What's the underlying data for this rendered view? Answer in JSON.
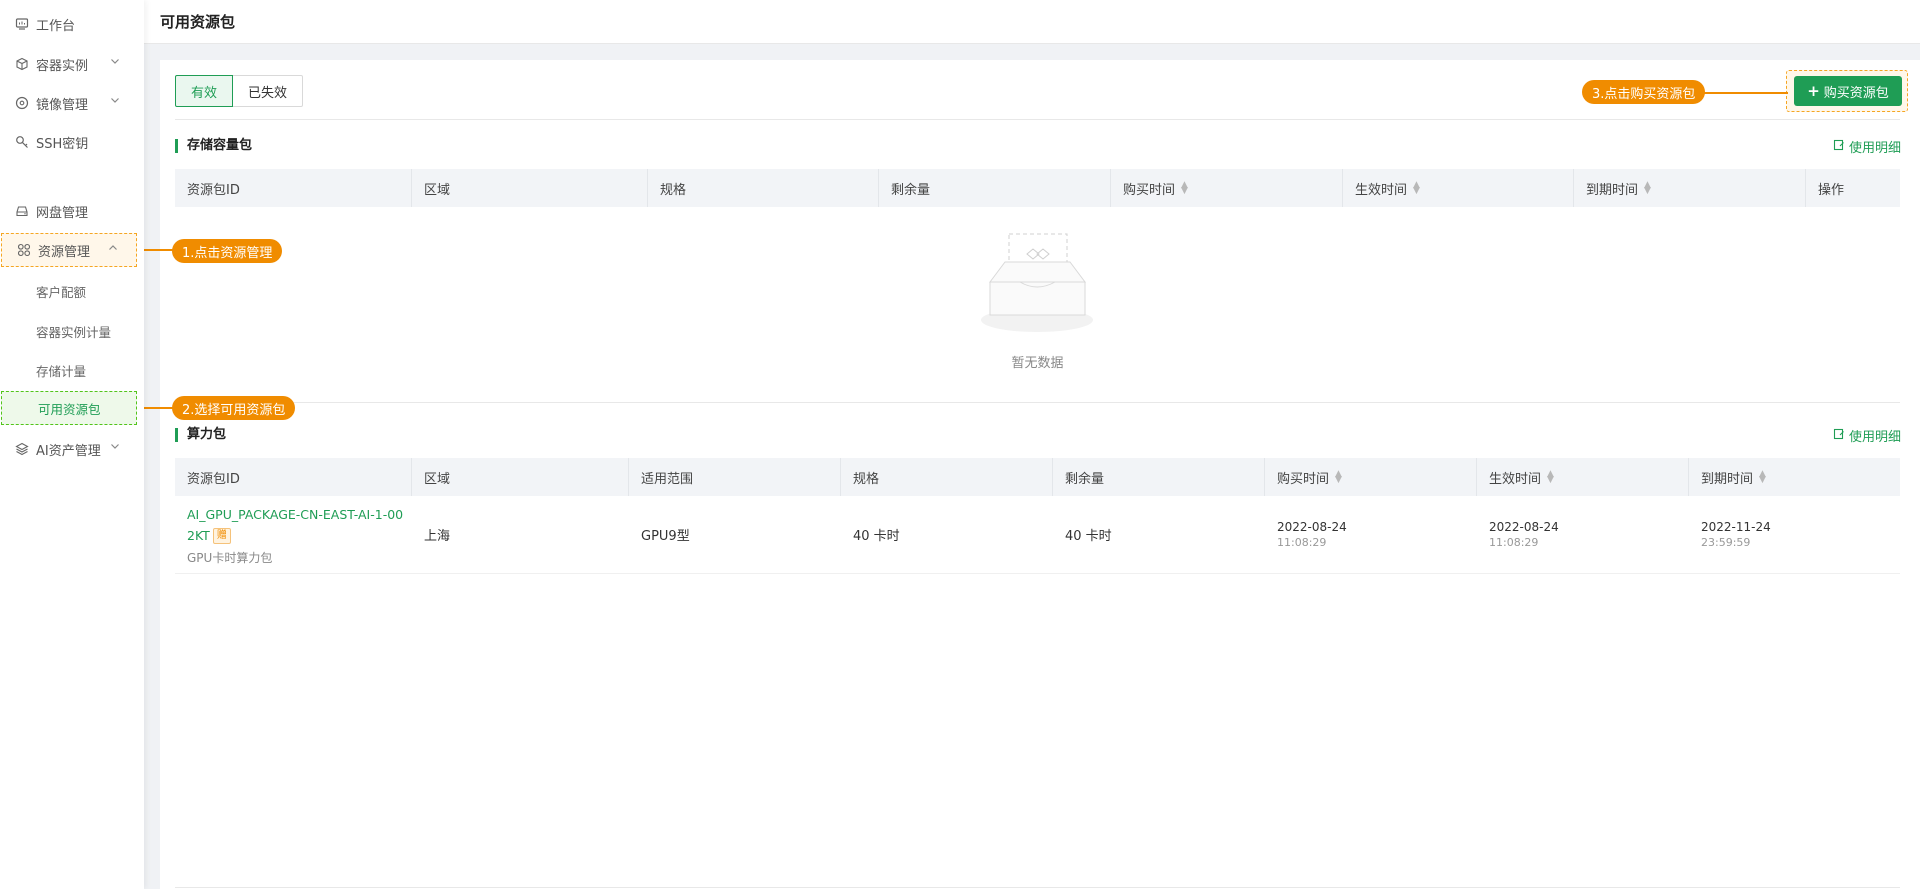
{
  "sidebar": {
    "items": [
      {
        "label": "工作台",
        "icon": "monitor-icon"
      },
      {
        "label": "容器实例",
        "icon": "cube-icon",
        "expand": "down"
      },
      {
        "label": "镜像管理",
        "icon": "disc-icon",
        "expand": "down"
      },
      {
        "label": "SSH密钥",
        "icon": "key-icon"
      },
      {
        "label": "网盘管理",
        "icon": "drive-icon"
      },
      {
        "label": "资源管理",
        "icon": "grid-icon",
        "expand": "up"
      },
      {
        "label": "AI资产管理",
        "icon": "layers-icon",
        "expand": "down"
      }
    ],
    "sub_items": [
      "客户配额",
      "容器实例计量",
      "存储计量",
      "可用资源包"
    ]
  },
  "header": {
    "title": "可用资源包"
  },
  "tabs": {
    "active": "有效",
    "inactive": "已失效"
  },
  "buy_button": {
    "label": "购买资源包"
  },
  "storage": {
    "title": "存储容量包",
    "detail_link": "使用明细",
    "columns": [
      "资源包ID",
      "区域",
      "规格",
      "剩余量",
      "购买时间",
      "生效时间",
      "到期时间",
      "操作"
    ],
    "empty_text": "暂无数据"
  },
  "compute": {
    "title": "算力包",
    "detail_link": "使用明细",
    "columns": [
      "资源包ID",
      "区域",
      "适用范围",
      "规格",
      "剩余量",
      "购买时间",
      "生效时间",
      "到期时间"
    ],
    "row": {
      "id_line1": "AI_GPU_PACKAGE-CN-EAST-AI-1-00",
      "id_line2": "2KT",
      "badge": "赠",
      "subtitle": "GPU卡时算力包",
      "region": "上海",
      "scope": "GPU9型",
      "spec": "40 卡时",
      "remaining": "40 卡时",
      "buy_date": "2022-08-24",
      "buy_time": "11:08:29",
      "start_date": "2022-08-24",
      "start_time": "11:08:29",
      "end_date": "2022-11-24",
      "end_time": "23:59:59"
    }
  },
  "callouts": {
    "step1": "1.点击资源管理",
    "step2": "2.选择可用资源包",
    "step3": "3.点击购买资源包"
  },
  "colors": {
    "primary": "#1f9d55",
    "callout": "#f08c00"
  }
}
